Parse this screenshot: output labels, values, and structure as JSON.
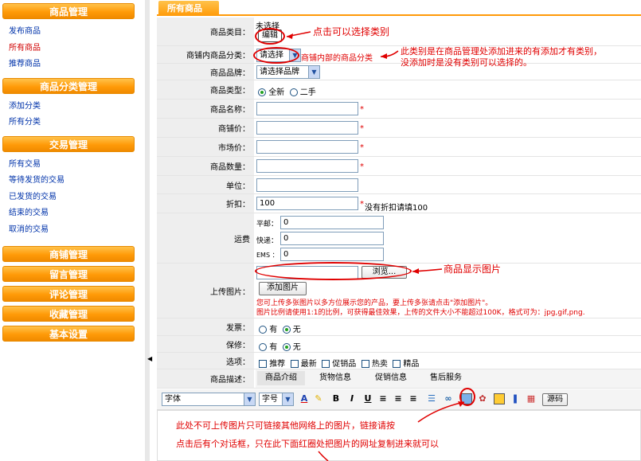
{
  "sidebar": {
    "sections": [
      {
        "title": "商品管理",
        "items": [
          "发布商品",
          "所有商品",
          "推荐商品"
        ]
      },
      {
        "title": "商品分类管理",
        "items": [
          "添加分类",
          "所有分类"
        ]
      },
      {
        "title": "交易管理",
        "items": [
          "所有交易",
          "等待发货的交易",
          "已发货的交易",
          "结束的交易",
          "取消的交易"
        ]
      },
      {
        "title": "商铺管理",
        "items": []
      },
      {
        "title": "留言管理",
        "items": []
      },
      {
        "title": "评论管理",
        "items": []
      },
      {
        "title": "收藏管理",
        "items": []
      },
      {
        "title": "基本设置",
        "items": []
      }
    ]
  },
  "main": {
    "title": "所有商品",
    "category": {
      "label": "商品类目：",
      "value": "未选择",
      "edit_button": "编辑"
    },
    "shop_category": {
      "label": "商铺内商品分类：",
      "selected": "请选择",
      "note": "商铺内部的商品分类"
    },
    "brand": {
      "label": "商品品牌：",
      "selected": "请选择品牌"
    },
    "type": {
      "label": "商品类型：",
      "options": [
        "全新",
        "二手"
      ]
    },
    "name": {
      "label": "商品名称：",
      "value": ""
    },
    "shop_price": {
      "label": "商铺价：",
      "value": ""
    },
    "market_price": {
      "label": "市场价：",
      "value": ""
    },
    "quantity": {
      "label": "商品数量：",
      "value": ""
    },
    "unit": {
      "label": "单位：",
      "value": ""
    },
    "discount": {
      "label": "折扣：",
      "value": "100",
      "hint": "没有折扣请填100"
    },
    "shipping": {
      "label": "运费",
      "items": [
        {
          "label": "平邮：",
          "value": "0"
        },
        {
          "label": "快递：",
          "value": "0"
        },
        {
          "label": "EMS ：",
          "value": "0"
        }
      ]
    },
    "upload": {
      "label": "上传图片：",
      "browse_button": "浏览...",
      "add_button": "添加图片",
      "hint1": "您可上传多张图片以多方位展示您的产品，要上传多张请点击\"添加图片\"。",
      "hint2": "图片比例请使用1:1的比例，可获得最佳效果，上传的文件大小不能超过100K，格式可为：jpg,gif,png."
    },
    "invoice": {
      "label": "发票：",
      "options": [
        "有",
        "无"
      ]
    },
    "warranty": {
      "label": "保修：",
      "options": [
        "有",
        "无"
      ]
    },
    "options": {
      "label": "选项：",
      "items": [
        "推荐",
        "最新",
        "促销品",
        "热卖",
        "精品"
      ]
    },
    "description": {
      "label": "商品描述：",
      "tabs": [
        "商品介绍",
        "货物信息",
        "促销信息",
        "售后服务"
      ]
    },
    "editor": {
      "font_select": "字体",
      "size_select": "字号",
      "source_button": "源码"
    }
  },
  "annotations": {
    "a1": "点击可以选择类别",
    "a2_line1": "此类别是在商品管理处添加进来的有添加才有类别，",
    "a2_line2": "没添加时是没有类别可以选择的。",
    "a3": "商品显示图片",
    "a4": "此处不可上传图片只可链接其他网络上的图片，链接请按",
    "a5": "点击后有个对话框，只在此下面红圈处把图片的网址复制进来就可以"
  }
}
